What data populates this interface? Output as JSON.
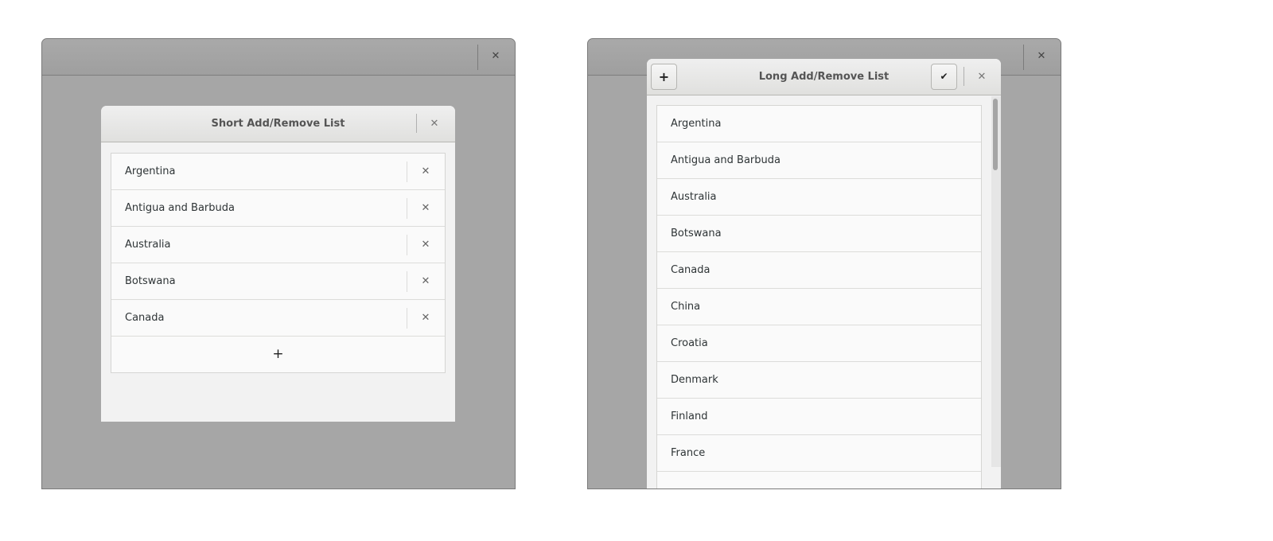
{
  "left_window": {
    "close_icon": "close-icon",
    "dialog": {
      "title": "Short Add/Remove List",
      "items": [
        "Argentina",
        "Antigua and Barbuda",
        "Australia",
        "Botswana",
        "Canada"
      ],
      "remove_glyph": "✕",
      "add_glyph": "+"
    }
  },
  "right_window": {
    "dialog": {
      "title": "Long Add/Remove List",
      "add_glyph": "+",
      "confirm_glyph": "✔",
      "items": [
        "Argentina",
        "Antigua and Barbuda",
        "Australia",
        "Botswana",
        "Canada",
        "China",
        "Croatia",
        "Denmark",
        "Finland",
        "France"
      ]
    }
  },
  "close_glyph": "✕"
}
